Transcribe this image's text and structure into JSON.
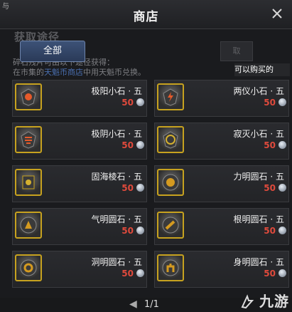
{
  "window": {
    "title": "商店",
    "corner_mark": "与"
  },
  "background": {
    "heading": "获取途径",
    "line1": "碎石残片可由以下途径获得：",
    "line2_prefix": "在市集的",
    "line2_link": "天魁币商店",
    "line2_suffix": "中用天魁币兑换。"
  },
  "tabs": {
    "all_label": "全部"
  },
  "dim_button": {
    "label": "取"
  },
  "filter": {
    "label": "可以购买的"
  },
  "items": [
    {
      "name": "极阳小石 · 五",
      "price": "50"
    },
    {
      "name": "两仪小石 · 五",
      "price": "50"
    },
    {
      "name": "极阴小石 · 五",
      "price": "50"
    },
    {
      "name": "寂灭小石 · 五",
      "price": "50"
    },
    {
      "name": "固海棱石 · 五",
      "price": "50"
    },
    {
      "name": "力明圆石 · 五",
      "price": "50"
    },
    {
      "name": "气明圆石 · 五",
      "price": "50"
    },
    {
      "name": "根明圆石 · 五",
      "price": "50"
    },
    {
      "name": "洞明圆石 · 五",
      "price": "50"
    },
    {
      "name": "身明圆石 · 五",
      "price": "50"
    }
  ],
  "pager": {
    "text": "1/1",
    "prev": "◀"
  },
  "watermark": {
    "text": "九游"
  },
  "colors": {
    "accent": "#c7a21f",
    "price": "#e04a3c",
    "tab": "#3d5277"
  }
}
